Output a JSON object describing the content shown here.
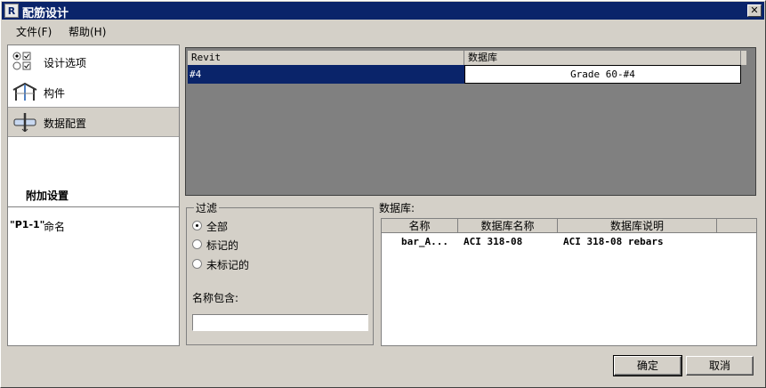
{
  "window": {
    "title": "配筋设计",
    "app_icon_letter": "R",
    "close_glyph": "✕"
  },
  "menu": {
    "file": "文件(F)",
    "help": "帮助(H)"
  },
  "nav": {
    "design_options": "设计选项",
    "components": "构件",
    "data_config": "数据配置",
    "additional_settings": "附加设置",
    "naming_tag": "\"P1-1\"",
    "naming": "命名"
  },
  "mapping": {
    "headers": [
      "Revit",
      "数据库"
    ],
    "rows": [
      {
        "revit": "#4",
        "database": "Grade 60-#4"
      }
    ]
  },
  "filter": {
    "title": "过滤",
    "options": [
      "全部",
      "标记的",
      "未标记的"
    ],
    "selected": "全部",
    "name_contains_label": "名称包含:",
    "name_contains_value": ""
  },
  "database": {
    "label": "数据库:",
    "headers": [
      "名称",
      "数据库名称",
      "数据库说明"
    ],
    "rows": [
      {
        "name": "bar_A...",
        "db_name": "ACI 318-08",
        "db_desc": "ACI 318-08 rebars"
      }
    ]
  },
  "buttons": {
    "ok": "确定",
    "cancel": "取消"
  }
}
